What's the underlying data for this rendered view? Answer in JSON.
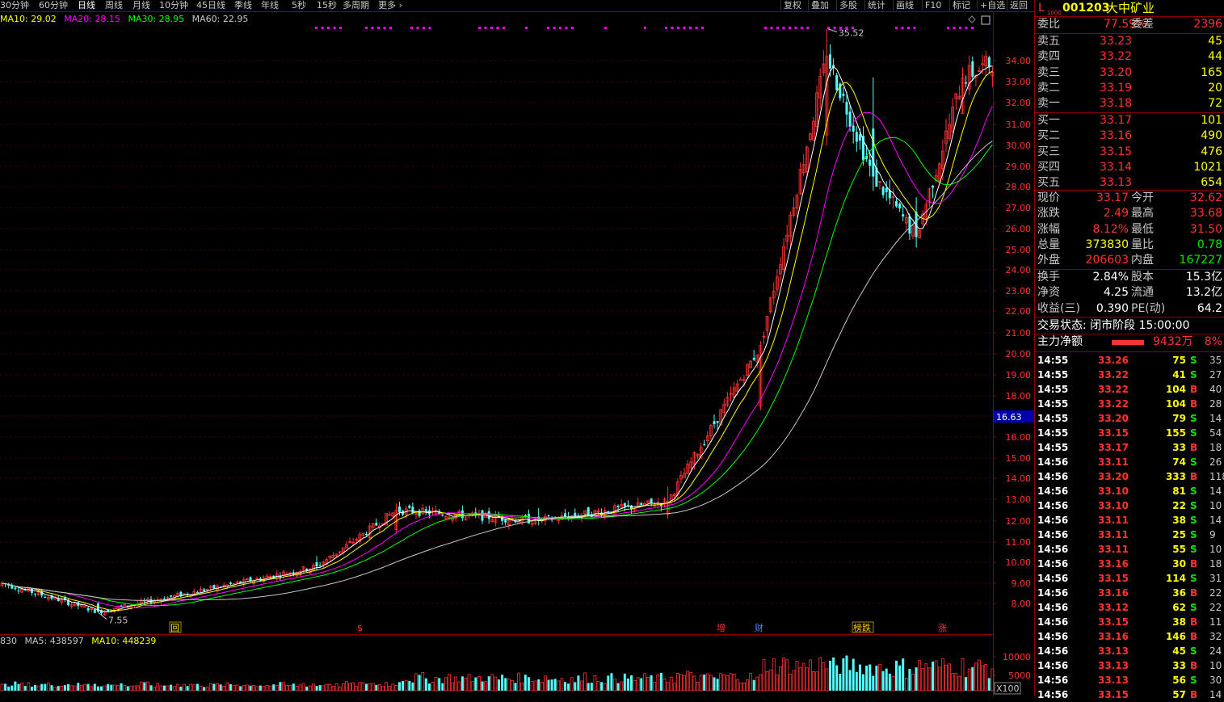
{
  "toolbar": {
    "periods": [
      "30分钟",
      "60分钟",
      "日线",
      "周线",
      "月线",
      "10分钟",
      "45日线",
      "季线",
      "年线",
      "5秒",
      "15秒",
      "多周期",
      "更多 ›"
    ],
    "active_period": "日线",
    "right_buttons": [
      "复权",
      "叠加",
      "多股",
      "统计",
      "画线",
      "F10",
      "标记",
      "+自选",
      "返回"
    ]
  },
  "ma_legend": {
    "ma10": "MA10: 29.02",
    "ma20": "MA20: 28.15",
    "ma30": "MA30: 28.95",
    "ma60": "MA60: 22.95"
  },
  "volume_legend": {
    "vol": "830",
    "ma5": "MA5: 438597",
    "ma10": "MA10: 448239"
  },
  "chart_data": {
    "type": "candlestick",
    "y_ticks": [
      "34.00",
      "33.00",
      "32.00",
      "31.00",
      "30.00",
      "29.00",
      "28.00",
      "27.00",
      "26.00",
      "25.00",
      "24.00",
      "23.00",
      "22.00",
      "21.00",
      "20.00",
      "19.00",
      "18.00",
      "17.00",
      "16.00",
      "15.00",
      "14.00",
      "13.00",
      "12.00",
      "11.00",
      "10.00",
      "9.00",
      "8.00"
    ],
    "y_values": [
      34,
      33,
      32,
      31,
      30,
      29,
      28,
      27,
      26,
      25,
      24,
      23,
      22,
      21,
      20,
      19,
      18,
      17,
      16,
      15,
      14,
      13,
      12,
      11,
      10,
      9,
      8
    ],
    "current_price_tag": "16.63",
    "high_marker": "35.52",
    "low_marker": "7.55",
    "volume_ticks": [
      "10000",
      "5000"
    ],
    "volume_unit": "X100",
    "event_markers": [
      "回",
      "$",
      "增",
      "财",
      "榜跌",
      "涨"
    ],
    "key_candles": [
      {
        "x": 0,
        "open": 8.9,
        "close": 9.0,
        "high": 9.1,
        "low": 8.8
      },
      {
        "x": 29,
        "open": 8.0,
        "close": 7.6,
        "high": 8.1,
        "low": 7.55
      },
      {
        "x": 95,
        "open": 10.0,
        "close": 9.8,
        "high": 10.3,
        "low": 9.6
      },
      {
        "x": 119,
        "open": 11.6,
        "close": 12.5,
        "high": 12.8,
        "low": 11.4
      },
      {
        "x": 162,
        "open": 12.2,
        "close": 12.0,
        "high": 12.6,
        "low": 11.8
      },
      {
        "x": 201,
        "open": 12.3,
        "close": 12.9,
        "high": 13.6,
        "low": 12.1
      },
      {
        "x": 229,
        "open": 17.5,
        "close": 20.4,
        "high": 20.6,
        "low": 17.3
      },
      {
        "x": 249,
        "open": 30.5,
        "close": 34.2,
        "high": 35.52,
        "low": 30.0
      },
      {
        "x": 263,
        "open": 30.8,
        "close": 28.5,
        "high": 33.2,
        "low": 27.8
      },
      {
        "x": 276,
        "open": 26.8,
        "close": 25.6,
        "high": 27.5,
        "low": 25.1
      },
      {
        "x": 290,
        "open": 31.5,
        "close": 33.17,
        "high": 33.68,
        "low": 31.5
      }
    ]
  },
  "quote": {
    "market": "L",
    "market_sub": "1000",
    "code": "001203",
    "name": "大中矿业",
    "weibi_label": "委比",
    "weibi": "77.59%",
    "weicha_label": "委差",
    "weicha": "2396",
    "asks": [
      {
        "label": "卖五",
        "price": "33.23",
        "vol": "45"
      },
      {
        "label": "卖四",
        "price": "33.22",
        "vol": "44"
      },
      {
        "label": "卖三",
        "price": "33.20",
        "vol": "165"
      },
      {
        "label": "卖二",
        "price": "33.19",
        "vol": "20"
      },
      {
        "label": "卖一",
        "price": "33.18",
        "vol": "72"
      }
    ],
    "bids": [
      {
        "label": "买一",
        "price": "33.17",
        "vol": "101"
      },
      {
        "label": "买二",
        "price": "33.16",
        "vol": "490"
      },
      {
        "label": "买三",
        "price": "33.15",
        "vol": "476"
      },
      {
        "label": "买四",
        "price": "33.14",
        "vol": "1021"
      },
      {
        "label": "买五",
        "price": "33.13",
        "vol": "654"
      }
    ],
    "stats": [
      {
        "l1": "现价",
        "v1": "33.17",
        "c1": "red",
        "l2": "今开",
        "v2": "32.62",
        "c2": "red"
      },
      {
        "l1": "涨跌",
        "v1": "2.49",
        "c1": "red",
        "l2": "最高",
        "v2": "33.68",
        "c2": "red"
      },
      {
        "l1": "涨幅",
        "v1": "8.12%",
        "c1": "red",
        "l2": "最低",
        "v2": "31.50",
        "c2": "red"
      },
      {
        "l1": "总量",
        "v1": "373830",
        "c1": "yel",
        "l2": "量比",
        "v2": "0.78",
        "c2": "grn"
      },
      {
        "l1": "外盘",
        "v1": "206603",
        "c1": "red",
        "l2": "内盘",
        "v2": "167227",
        "c2": "grn"
      }
    ],
    "stats2": [
      {
        "l1": "换手",
        "v1": "2.84%",
        "l2": "股本",
        "v2": "15.3亿"
      },
      {
        "l1": "净资",
        "v1": "4.25",
        "l2": "流通",
        "v2": "13.2亿"
      },
      {
        "l1": "收益(三)",
        "v1": "0.390",
        "l2": "PE(动)",
        "v2": "64.2"
      }
    ],
    "trade_status": "交易状态: 闭市阶段 15:00:00",
    "main_net_label": "主力净额",
    "main_net_value": "9432万",
    "main_net_pct": "8%"
  },
  "ticks": [
    {
      "t": "14:55",
      "p": "33.26",
      "v": "75",
      "s": "S",
      "n": "35"
    },
    {
      "t": "14:55",
      "p": "33.22",
      "v": "41",
      "s": "S",
      "n": "27"
    },
    {
      "t": "14:55",
      "p": "33.22",
      "v": "104",
      "s": "B",
      "n": "40"
    },
    {
      "t": "14:55",
      "p": "33.22",
      "v": "104",
      "s": "B",
      "n": "28"
    },
    {
      "t": "14:55",
      "p": "33.20",
      "v": "79",
      "s": "S",
      "n": "14"
    },
    {
      "t": "14:55",
      "p": "33.15",
      "v": "155",
      "s": "S",
      "n": "54"
    },
    {
      "t": "14:55",
      "p": "33.17",
      "v": "33",
      "s": "B",
      "n": "18"
    },
    {
      "t": "14:56",
      "p": "33.11",
      "v": "74",
      "s": "S",
      "n": "26"
    },
    {
      "t": "14:56",
      "p": "33.20",
      "v": "333",
      "s": "B",
      "n": "118"
    },
    {
      "t": "14:56",
      "p": "33.10",
      "v": "81",
      "s": "S",
      "n": "14"
    },
    {
      "t": "14:56",
      "p": "33.10",
      "v": "22",
      "s": "S",
      "n": "10"
    },
    {
      "t": "14:56",
      "p": "33.11",
      "v": "38",
      "s": "S",
      "n": "14"
    },
    {
      "t": "14:56",
      "p": "33.11",
      "v": "25",
      "s": "S",
      "n": "9"
    },
    {
      "t": "14:56",
      "p": "33.11",
      "v": "55",
      "s": "S",
      "n": "10"
    },
    {
      "t": "14:56",
      "p": "33.16",
      "v": "30",
      "s": "B",
      "n": "18"
    },
    {
      "t": "14:56",
      "p": "33.15",
      "v": "114",
      "s": "S",
      "n": "31"
    },
    {
      "t": "14:56",
      "p": "33.16",
      "v": "36",
      "s": "B",
      "n": "22"
    },
    {
      "t": "14:56",
      "p": "33.12",
      "v": "62",
      "s": "S",
      "n": "22"
    },
    {
      "t": "14:56",
      "p": "33.15",
      "v": "38",
      "s": "B",
      "n": "11"
    },
    {
      "t": "14:56",
      "p": "33.16",
      "v": "146",
      "s": "B",
      "n": "32"
    },
    {
      "t": "14:56",
      "p": "33.13",
      "v": "45",
      "s": "S",
      "n": "24"
    },
    {
      "t": "14:56",
      "p": "33.13",
      "v": "33",
      "s": "B",
      "n": "10"
    },
    {
      "t": "14:56",
      "p": "33.13",
      "v": "56",
      "s": "S",
      "n": "30"
    },
    {
      "t": "14:56",
      "p": "33.15",
      "v": "57",
      "s": "B",
      "n": "14"
    }
  ],
  "colors": {
    "up": "#ff3232",
    "down": "#54ffff",
    "ma5": "#ffffff",
    "ma10": "#ffff00",
    "ma20": "#ff00ff",
    "ma30": "#00ff00",
    "ma60": "#c8c8c8",
    "grid": "#8b0000"
  }
}
